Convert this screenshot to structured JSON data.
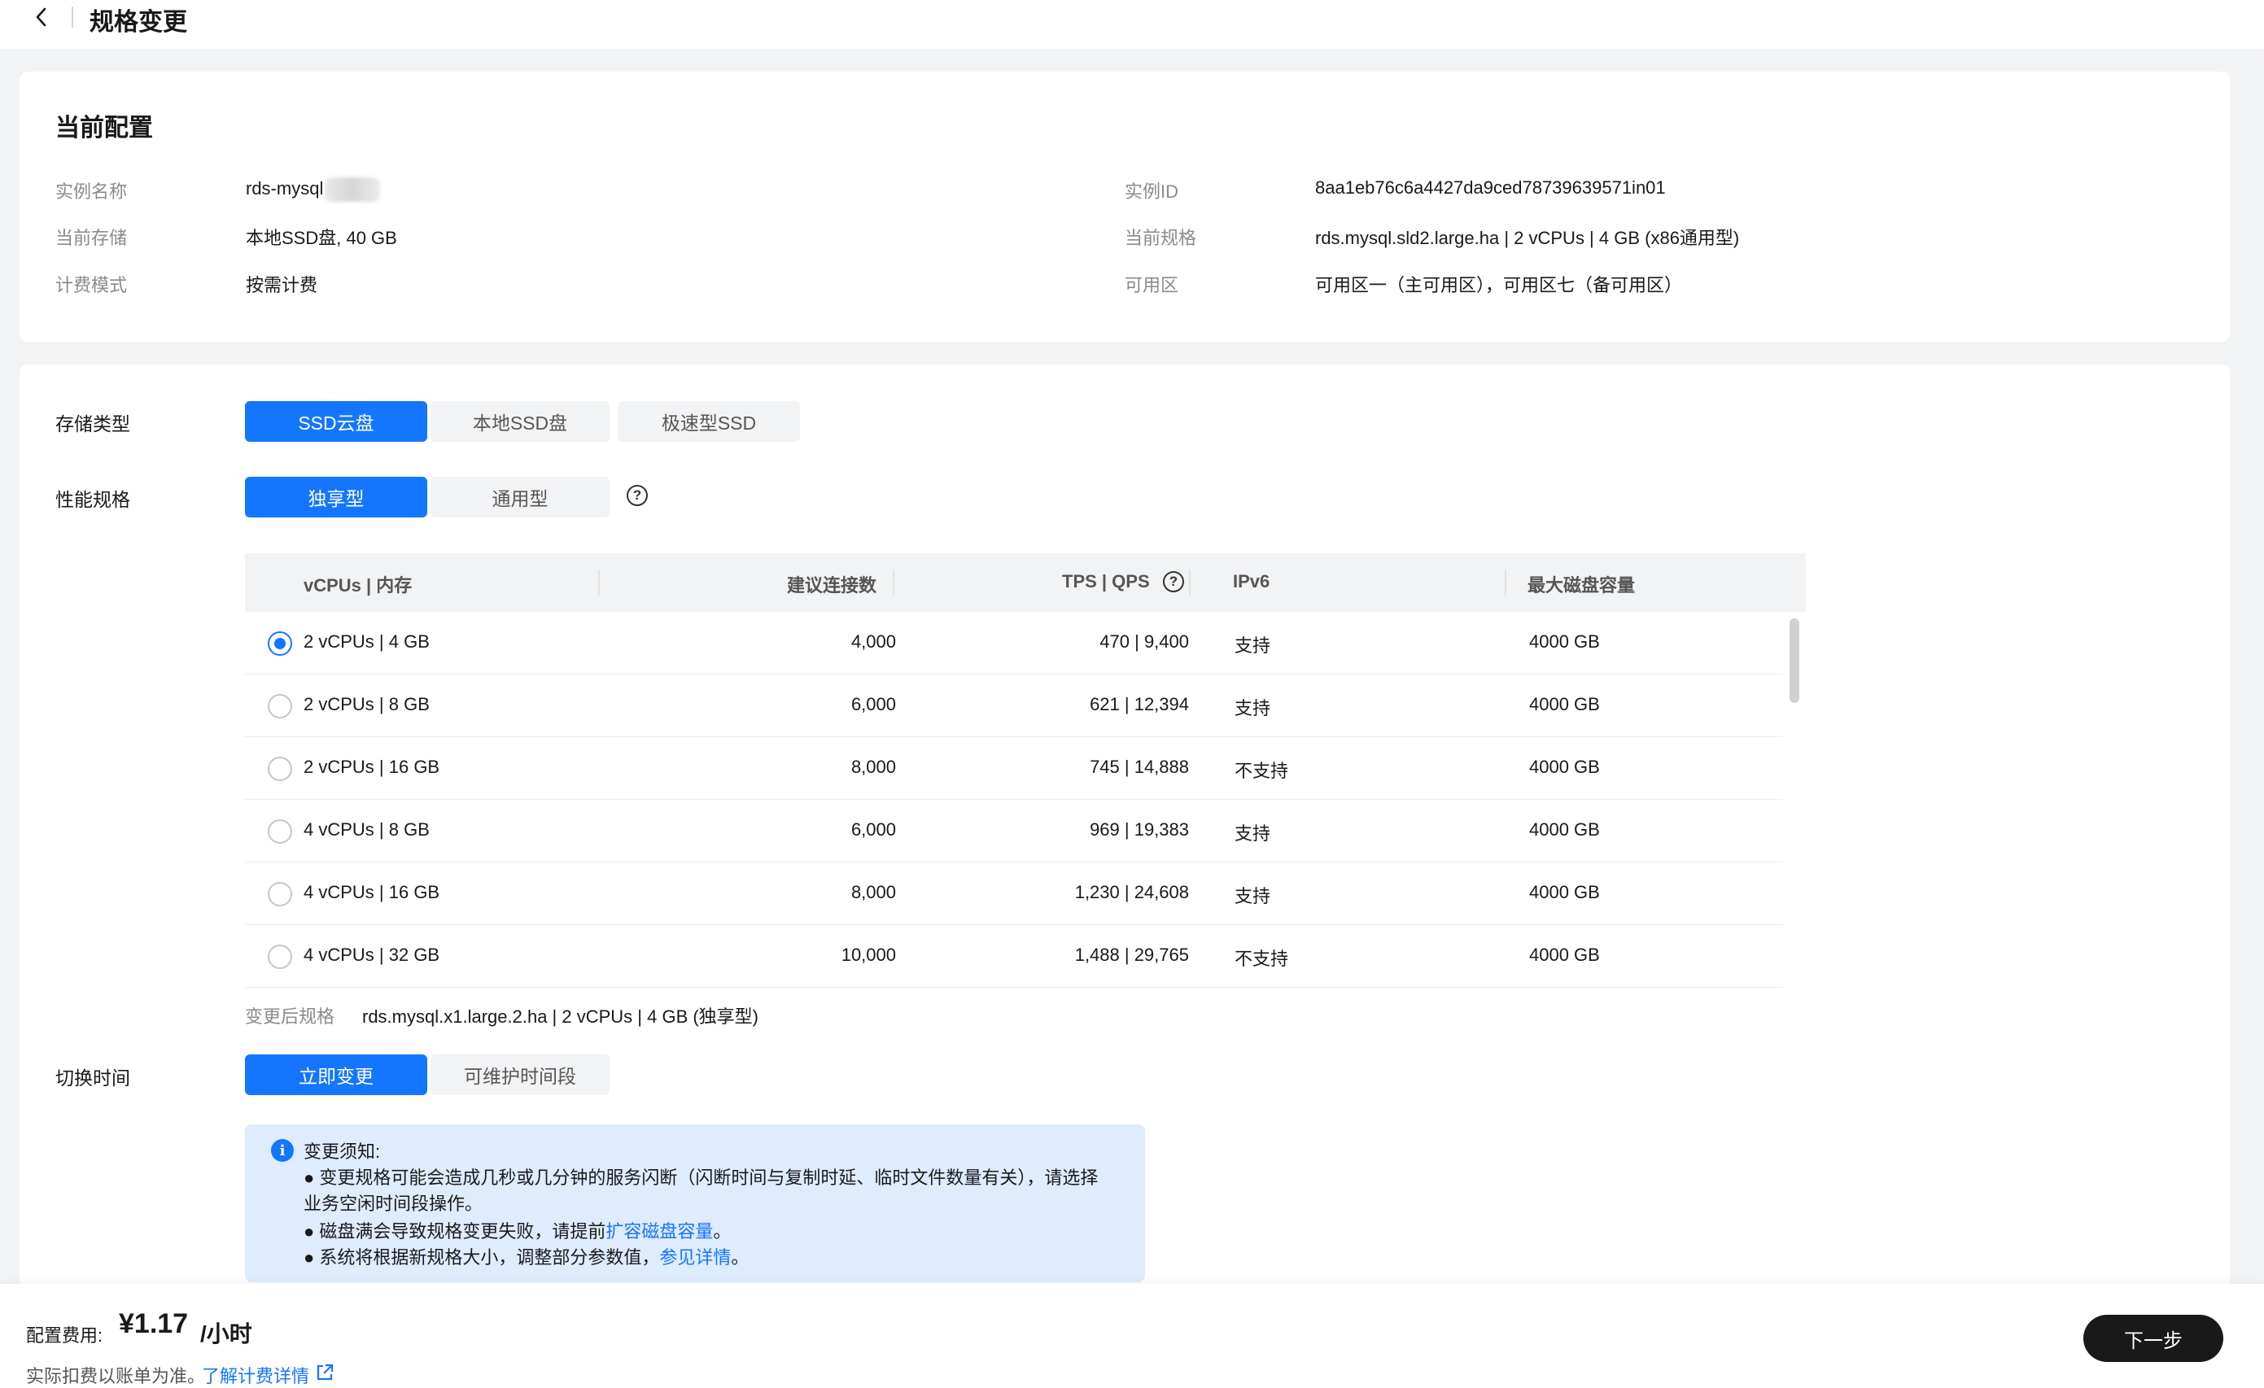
{
  "header": {
    "title": "规格变更"
  },
  "current_config": {
    "title": "当前配置",
    "left": [
      {
        "label": "实例名称",
        "value": "rds-mysql"
      },
      {
        "label": "当前存储",
        "value": "本地SSD盘, 40 GB"
      },
      {
        "label": "计费模式",
        "value": "按需计费"
      }
    ],
    "right": [
      {
        "label": "实例ID",
        "value": "8aa1eb76c6a4427da9ced78739639571in01"
      },
      {
        "label": "当前规格",
        "value": "rds.mysql.sld2.large.ha | 2 vCPUs | 4 GB (x86通用型)"
      },
      {
        "label": "可用区",
        "value": "可用区一（主可用区），可用区七（备可用区）"
      }
    ]
  },
  "storage": {
    "label": "存储类型",
    "options": [
      "SSD云盘",
      "本地SSD盘",
      "极速型SSD"
    ],
    "selected": "SSD云盘"
  },
  "performance": {
    "label": "性能规格",
    "options": [
      "独享型",
      "通用型"
    ],
    "selected": "独享型"
  },
  "table": {
    "headers": [
      "vCPUs | 内存",
      "建议连接数",
      "TPS | QPS",
      "IPv6",
      "最大磁盘容量"
    ],
    "rows": [
      {
        "spec": "2 vCPUs | 4 GB",
        "conn": "4,000",
        "tps": "470 | 9,400",
        "ipv6": "支持",
        "disk": "4000 GB",
        "selected": true
      },
      {
        "spec": "2 vCPUs | 8 GB",
        "conn": "6,000",
        "tps": "621 | 12,394",
        "ipv6": "支持",
        "disk": "4000 GB",
        "selected": false
      },
      {
        "spec": "2 vCPUs | 16 GB",
        "conn": "8,000",
        "tps": "745 | 14,888",
        "ipv6": "不支持",
        "disk": "4000 GB",
        "selected": false
      },
      {
        "spec": "4 vCPUs | 8 GB",
        "conn": "6,000",
        "tps": "969 | 19,383",
        "ipv6": "支持",
        "disk": "4000 GB",
        "selected": false
      },
      {
        "spec": "4 vCPUs | 16 GB",
        "conn": "8,000",
        "tps": "1,230 | 24,608",
        "ipv6": "支持",
        "disk": "4000 GB",
        "selected": false
      },
      {
        "spec": "4 vCPUs | 32 GB",
        "conn": "10,000",
        "tps": "1,488 | 29,765",
        "ipv6": "不支持",
        "disk": "4000 GB",
        "selected": false
      }
    ]
  },
  "after_spec": {
    "label": "变更后规格",
    "value": "rds.mysql.x1.large.2.ha | 2 vCPUs | 4 GB (独享型)"
  },
  "switch_time": {
    "label": "切换时间",
    "options": [
      "立即变更",
      "可维护时间段"
    ],
    "selected": "立即变更"
  },
  "notice": {
    "title": "变更须知:",
    "line1": "● 变更规格可能会造成几秒或几分钟的服务闪断（闪断时间与复制时延、临时文件数量有关），请选择",
    "line1b": "业务空闲时间段操作。",
    "line2_pre": "● 磁盘满会导致规格变更失败，请提前",
    "line2_link": "扩容磁盘容量",
    "line2_post": "。",
    "line3_pre": "● 系统将根据新规格大小，调整部分参数值，",
    "line3_link": "参见详情",
    "line3_post": "。"
  },
  "footer": {
    "fee_label": "配置费用:",
    "fee_amount": "¥1.17",
    "fee_unit": "/小时",
    "note": "实际扣费以账单为准。",
    "link": "了解计费详情",
    "next": "下一步"
  },
  "colors": {
    "accent": "#1476ff",
    "notice_bg": "#dfebff",
    "page_bg": "#f2f3f5"
  }
}
